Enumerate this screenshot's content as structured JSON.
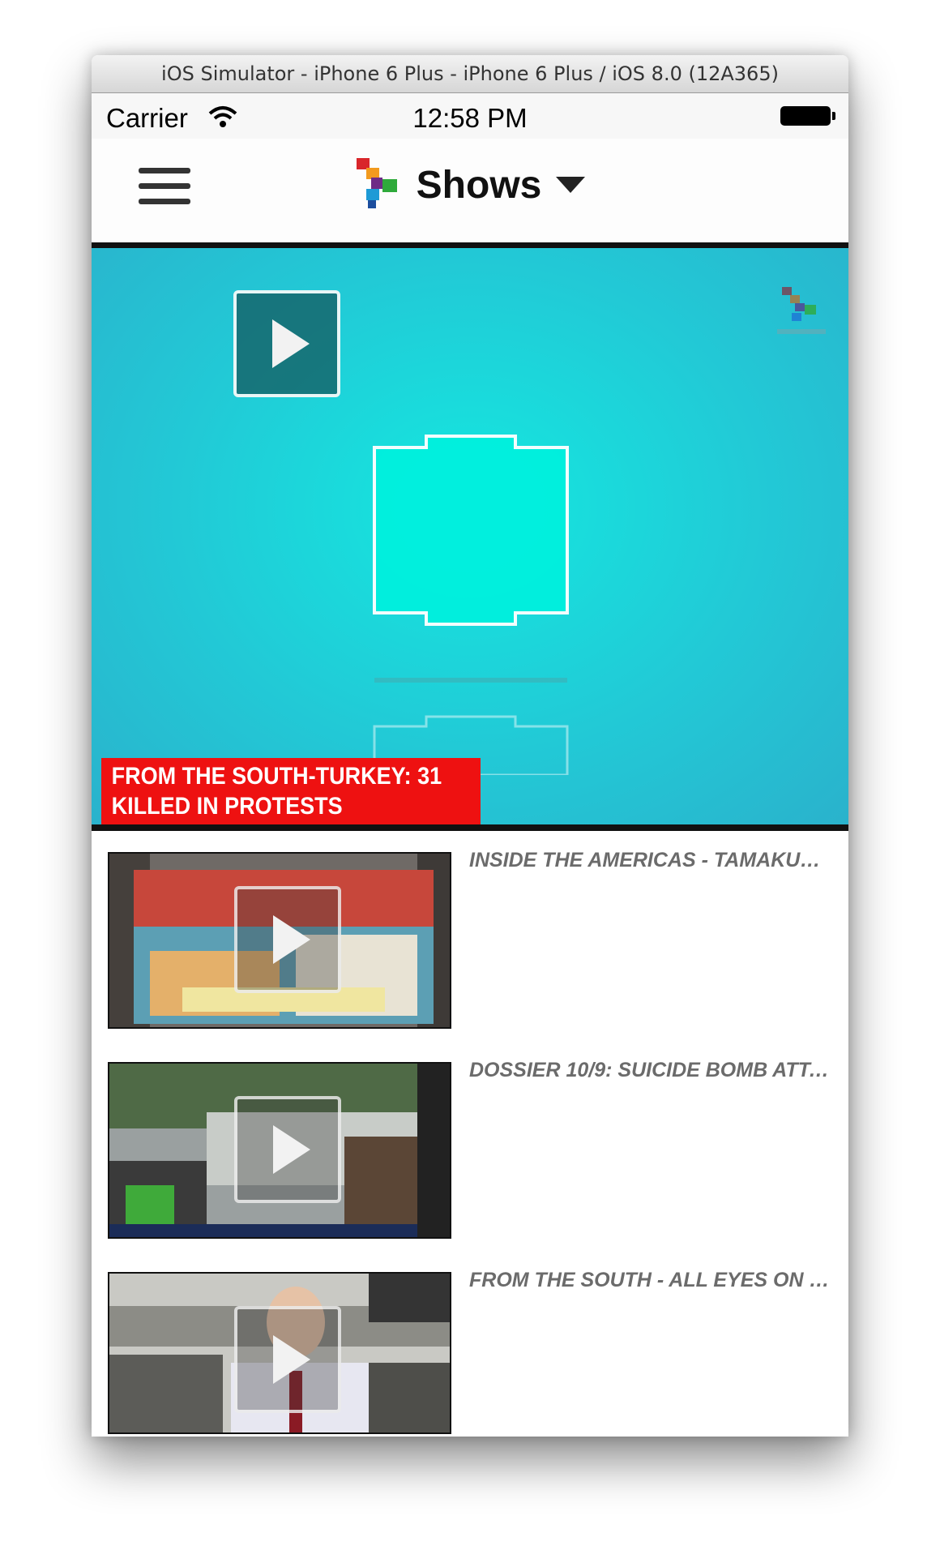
{
  "simulator": {
    "title": "iOS Simulator - iPhone 6 Plus - iPhone 6 Plus / iOS 8.0 (12A365)"
  },
  "status_bar": {
    "carrier": "Carrier",
    "time": "12:58 PM"
  },
  "nav": {
    "title": "Shows"
  },
  "hero": {
    "caption": "FROM THE SOUTH-TURKEY: 31 KILLED IN PROTESTS",
    "color": "#22c9d6",
    "caption_color": "#ee1111"
  },
  "videos": [
    {
      "title": "INSIDE THE AMERICAS - TAMAKUN, THE..."
    },
    {
      "title": "DOSSIER 10/9: SUICIDE BOMB ATTACKS..."
    },
    {
      "title": "FROM THE SOUTH - ALL EYES ON BOLIVI..."
    }
  ]
}
